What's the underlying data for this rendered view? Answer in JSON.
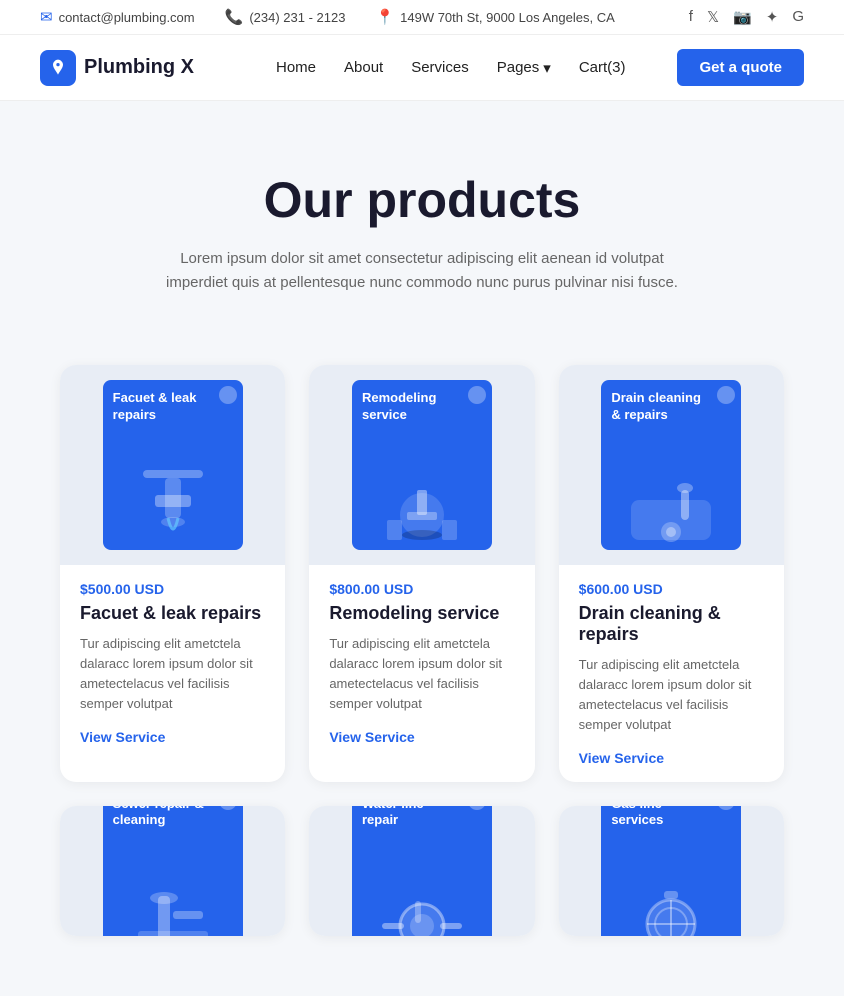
{
  "topbar": {
    "email": "contact@plumbing.com",
    "phone": "(234) 231 - 2123",
    "address": "149W 70th St, 9000 Los Angeles, CA",
    "socials": [
      "f",
      "t",
      "i",
      "y",
      "g"
    ]
  },
  "navbar": {
    "logo_text": "Plumbing X",
    "links": [
      {
        "label": "Home",
        "href": "#"
      },
      {
        "label": "About",
        "href": "#"
      },
      {
        "label": "Services",
        "href": "#"
      },
      {
        "label": "Pages",
        "href": "#",
        "dropdown": true
      },
      {
        "label": "Cart(3)",
        "href": "#"
      }
    ],
    "cta_label": "Get a quote"
  },
  "hero": {
    "title": "Our products",
    "subtitle": "Lorem ipsum dolor sit amet consectetur adipiscing elit aenean id volutpat imperdiet quis at pellentesque nunc commodo nunc purus pulvinar nisi fusce."
  },
  "products": [
    {
      "price": "$500.00 USD",
      "name": "Facuet & leak repairs",
      "card_title": "Facuet & leak repairs",
      "description": "Tur adipiscing elit ametctela dalaracc lorem ipsum dolor sit ametectelacus vel facilisis semper volutpat",
      "view_label": "View Service",
      "color": "#2563eb",
      "icon_type": "faucet"
    },
    {
      "price": "$800.00 USD",
      "name": "Remodeling service",
      "card_title": "Remodeling service",
      "description": "Tur adipiscing elit ametctela dalaracc lorem ipsum dolor sit ametectelacus vel facilisis semper volutpat",
      "view_label": "View Service",
      "color": "#2563eb",
      "icon_type": "remodel"
    },
    {
      "price": "$600.00 USD",
      "name": "Drain cleaning & repairs",
      "card_title": "Drain cleaning & repairs",
      "description": "Tur adipiscing elit ametctela dalaracc lorem ipsum dolor sit ametectelacus vel facilisis semper volutpat",
      "view_label": "View Service",
      "color": "#2563eb",
      "icon_type": "drain"
    },
    {
      "name": "Sewer repair & cleaning",
      "card_title": "Sewer repair & cleaning",
      "color": "#2563eb",
      "icon_type": "sewer"
    },
    {
      "name": "Water line repair",
      "card_title": "Water line repair",
      "color": "#2563eb",
      "icon_type": "waterline"
    },
    {
      "name": "Gas line services",
      "card_title": "Gas line services",
      "color": "#2563eb",
      "icon_type": "gas"
    }
  ]
}
